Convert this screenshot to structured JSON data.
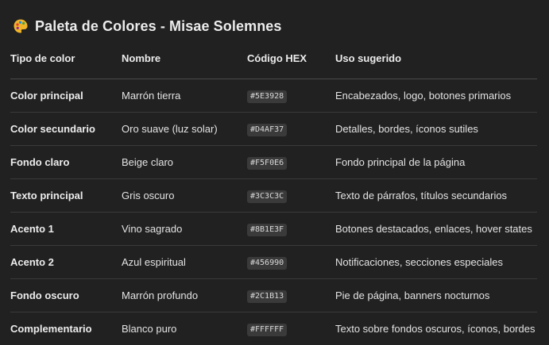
{
  "title": "Paleta de Colores - Misae Solemnes",
  "title_icon": "artist-palette-icon",
  "table": {
    "headers": [
      "Tipo de color",
      "Nombre",
      "Código HEX",
      "Uso sugerido"
    ],
    "rows": [
      {
        "type": "Color principal",
        "name": "Marrón tierra",
        "hex": "#5E3928",
        "use": "Encabezados, logo, botones primarios"
      },
      {
        "type": "Color secundario",
        "name": "Oro suave (luz solar)",
        "hex": "#D4AF37",
        "use": "Detalles, bordes, íconos sutiles"
      },
      {
        "type": "Fondo claro",
        "name": "Beige claro",
        "hex": "#F5F0E6",
        "use": "Fondo principal de la página"
      },
      {
        "type": "Texto principal",
        "name": "Gris oscuro",
        "hex": "#3C3C3C",
        "use": "Texto de párrafos, títulos secundarios"
      },
      {
        "type": "Acento 1",
        "name": "Vino sagrado",
        "hex": "#8B1E3F",
        "use": "Botones destacados, enlaces, hover states"
      },
      {
        "type": "Acento 2",
        "name": "Azul espiritual",
        "hex": "#456990",
        "use": "Notificaciones, secciones especiales"
      },
      {
        "type": "Fondo oscuro",
        "name": "Marrón profundo",
        "hex": "#2C1B13",
        "use": "Pie de página, banners nocturnos"
      },
      {
        "type": "Complementario",
        "name": "Blanco puro",
        "hex": "#FFFFFF",
        "use": "Texto sobre fondos oscuros, íconos, bordes"
      }
    ]
  },
  "colors": {
    "background": "#212121",
    "text": "#ececec",
    "code_background": "#3a3a3a"
  }
}
